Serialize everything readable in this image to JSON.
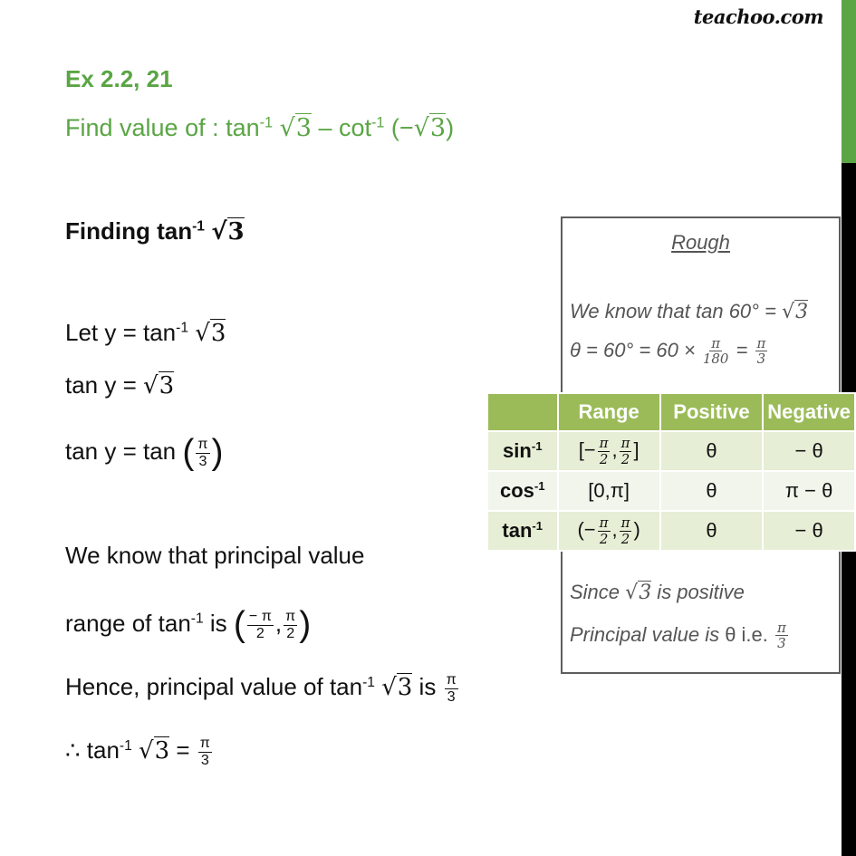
{
  "brand": {
    "logo_text": "teachoo.com",
    "accent_color": "#5aa544"
  },
  "header": {
    "exercise": "Ex 2.2, 21",
    "question_prefix": "Find value of : tan",
    "question_sup1": "-1",
    "question_sqrt1": "3",
    "question_mid": " – cot",
    "question_sup2": "-1",
    "question_open": " (−",
    "question_sqrt2": "3",
    "question_close": ")"
  },
  "solution": {
    "heading_prefix": "Finding  tan",
    "heading_sup": "-1",
    "heading_sqrt": "3",
    "step1_prefix": "Let y =  tan",
    "step1_sup": "-1",
    "step1_sqrt": "3",
    "step2_prefix": "tan y = ",
    "step2_sqrt": "3",
    "step3_prefix": "tan y = tan ",
    "step3_num": "π",
    "step3_den": "3",
    "step4": "We know that principal value",
    "step5_prefix": "range of tan",
    "step5_sup": "-1",
    "step5_mid": " is ",
    "step5_num1": "− π",
    "step5_den1": "2",
    "step5_num2": "π",
    "step5_den2": "2",
    "step6_prefix": "Hence, principal value of tan",
    "step6_sup": "-1",
    "step6_sqrt": "3",
    "step6_mid": " is ",
    "step6_num": "π",
    "step6_den": "3",
    "step7_prefix": "∴ tan",
    "step7_sup": "-1",
    "step7_sqrt": "3",
    "step7_mid": " = ",
    "step7_num": "π",
    "step7_den": "3"
  },
  "rough": {
    "title": "Rough",
    "line1_prefix": "We know that tan 60° = ",
    "line1_sqrt": "3",
    "line2_prefix": "θ = 60° = 60 ×  ",
    "line2_num": "π",
    "line2_den": "180",
    "line2_eq": " = ",
    "line2_num2": "π",
    "line2_den2": "3",
    "line3_prefix": "Since ",
    "line3_sqrt": "3",
    "line3_suffix": " is positive",
    "line4_prefix": "Principal value is  ",
    "line4_theta": "θ i.e. ",
    "line4_num": "π",
    "line4_den": "3"
  },
  "table": {
    "headers": [
      "",
      "Range",
      "Positive",
      "Negative"
    ],
    "rows": [
      {
        "fn": "sin",
        "sup": "-1",
        "range_open": "[−",
        "range_close": "]",
        "n1": "π",
        "d1": "2",
        "n2": "π",
        "d2": "2",
        "range_text": "",
        "positive": "θ",
        "negative": "− θ"
      },
      {
        "fn": "cos",
        "sup": "-1",
        "range_text": "[0,π]",
        "positive": "θ",
        "negative": "π − θ"
      },
      {
        "fn": "tan",
        "sup": "-1",
        "range_open": "(−",
        "range_close": ")",
        "n1": "π",
        "d1": "2",
        "n2": "π",
        "d2": "2",
        "range_text": "",
        "positive": "θ",
        "negative": "− θ"
      }
    ],
    "header_color": "#9bbb59",
    "row_color_odd": "#e6eed5",
    "row_color_even": "#f2f5ec"
  }
}
